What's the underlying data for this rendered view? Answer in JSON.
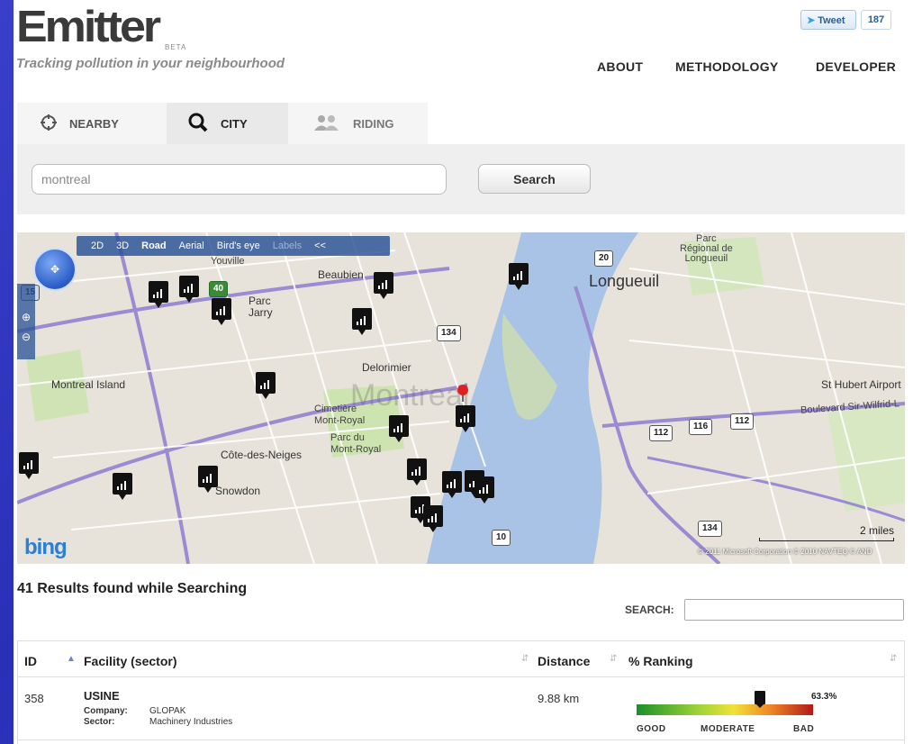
{
  "header": {
    "logo": "Emitter",
    "beta": "BETA",
    "tagline": "Tracking pollution in your neighbourhood",
    "nav": [
      "ABOUT",
      "METHODOLOGY",
      "DEVELOPER"
    ],
    "tweet_label": "Tweet",
    "tweet_count": "187"
  },
  "tabs": [
    {
      "label": "NEARBY",
      "icon": "crosshair-icon"
    },
    {
      "label": "CITY",
      "icon": "magnifier-icon"
    },
    {
      "label": "RIDING",
      "icon": "people-icon"
    }
  ],
  "search": {
    "value": "montreal",
    "button_label": "Search"
  },
  "map": {
    "toolbar": [
      "2D",
      "3D",
      "Road",
      "Aerial",
      "Bird's eye",
      "Labels",
      "<<"
    ],
    "labels": {
      "youville": "Youville",
      "beaubien": "Beaubien",
      "parc_jarry": "Parc\nJarry",
      "delorimier": "Delorimier",
      "montreal_island": "Montreal Island",
      "cimetiere": "Cimetière\nMont-Royal",
      "parc_du": "Parc du\nMont-Royal",
      "cote_des_neiges": "Côte-des-Neiges",
      "snowdon": "Snowdon",
      "longueuil": "Longueuil",
      "parc_regional": "Parc\nRégional de\nLongueuil",
      "st_hubert": "St Hubert Airport",
      "montreal": "Montreal",
      "blvd_sir_wilfrid": "Boulevard Sir-Wilfrid-L"
    },
    "shields": [
      "20",
      "134",
      "116",
      "112",
      "112",
      "134",
      "10",
      "40",
      "15"
    ],
    "bing": "bing",
    "scale": "2 miles",
    "copyright": "© 2011 Microsoft Corporation  © 2010 NAVTEQ  © AND"
  },
  "results": {
    "title": "41 Results found while Searching",
    "search_label": "SEARCH:",
    "search_value": "",
    "columns": [
      "ID",
      "Facility (sector)",
      "Distance",
      "% Ranking"
    ],
    "rows": [
      {
        "id": "358",
        "facility": "USINE",
        "company_label": "Company:",
        "company": "GLOPAK",
        "sector_label": "Sector:",
        "sector": "Machinery Industries",
        "distance": "9.88 km",
        "ranking": "63.3%",
        "ranking_fraction": 0.7
      }
    ],
    "legend": [
      "GOOD",
      "MODERATE",
      "BAD"
    ]
  }
}
